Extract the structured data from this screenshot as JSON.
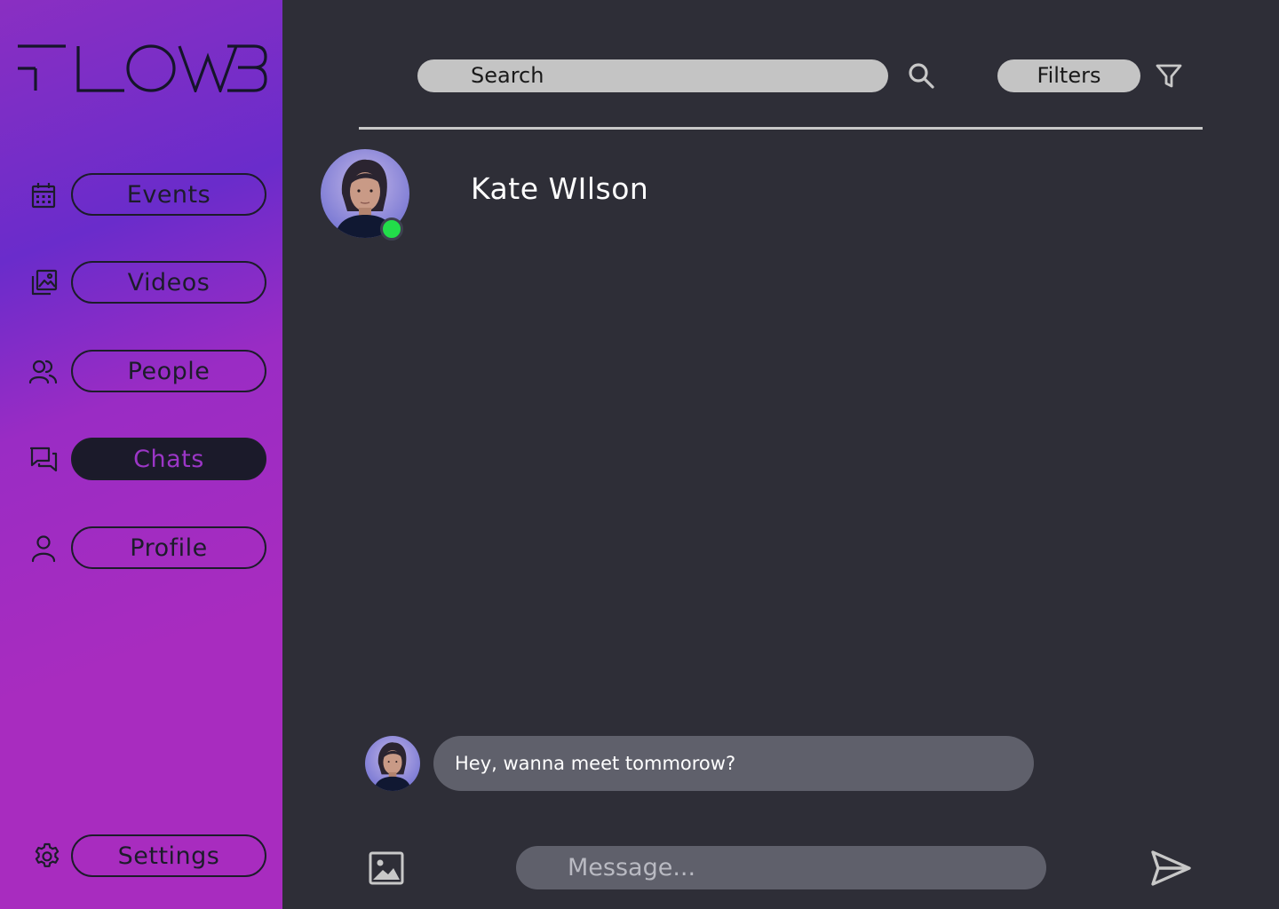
{
  "app": {
    "logo_text": "FLOW3"
  },
  "sidebar": {
    "items": [
      {
        "label": "Events",
        "icon": "calendar-icon",
        "active": false
      },
      {
        "label": "Videos",
        "icon": "gallery-icon",
        "active": false
      },
      {
        "label": "People",
        "icon": "people-icon",
        "active": false
      },
      {
        "label": "Chats",
        "icon": "chat-icon",
        "active": true
      },
      {
        "label": "Profile",
        "icon": "user-icon",
        "active": false
      }
    ],
    "settings": {
      "label": "Settings",
      "icon": "gear-icon"
    }
  },
  "header": {
    "search_label": "Search",
    "filters_label": "Filters"
  },
  "chat": {
    "contact_name": "Kate WIlson",
    "status": "online",
    "messages": [
      {
        "from": "Kate WIlson",
        "text": "Hey, wanna meet tommorow?"
      }
    ],
    "input_placeholder": "Message..."
  },
  "colors": {
    "sidebar_gradient_start": "#8a2fc2",
    "sidebar_gradient_end": "#a82cbf",
    "background": "#2e2e37",
    "active_pill": "#1b1a2a",
    "active_text": "#9b36c6",
    "online": "#22dd4a",
    "bubble": "#5f606b"
  }
}
